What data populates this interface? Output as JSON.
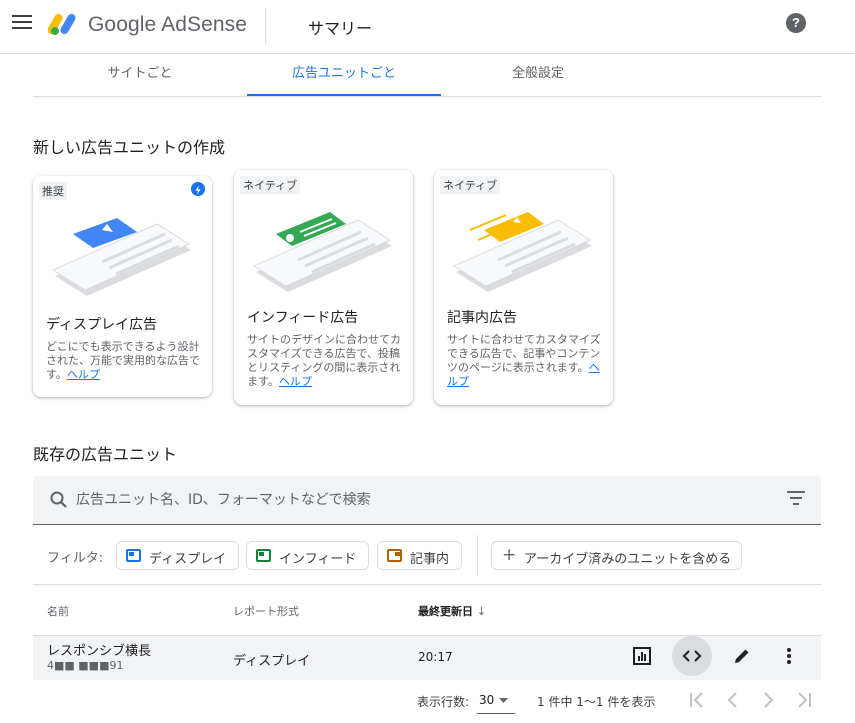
{
  "header": {
    "brand": "Google AdSense",
    "title": "サマリー",
    "help_icon": "?"
  },
  "tabs": [
    {
      "label": "サイトごと",
      "active": false
    },
    {
      "label": "広告ユニットごと",
      "active": true
    },
    {
      "label": "全般設定",
      "active": false
    }
  ],
  "create_section": {
    "title": "新しい広告ユニットの作成",
    "cards": [
      {
        "badge": "推奨",
        "title": "ディスプレイ広告",
        "description": "どこにでも表示できるよう設計された、万能で実用的な広告です。",
        "help": "ヘルプ",
        "accent": "#4285f4",
        "icon": "bolt-icon"
      },
      {
        "badge": "ネイティブ",
        "title": "インフィード広告",
        "description": "サイトのデザインに合わせてカスタマイズできる広告で、投稿とリスティングの間に表示されます。",
        "help": "ヘルプ",
        "accent": "#34a853"
      },
      {
        "badge": "ネイティブ",
        "title": "記事内広告",
        "description": "サイトに合わせてカスタマイズできる広告で、記事やコンテンツのページに表示されます。",
        "help": "ヘルプ",
        "accent": "#fbbc04"
      }
    ]
  },
  "existing_section": {
    "title": "既存の広告ユニット",
    "search": {
      "placeholder": "広告ユニット名、ID、フォーマットなどで検索",
      "value": ""
    },
    "filter": {
      "label": "フィルタ:",
      "chips": [
        {
          "label": "ディスプレイ",
          "color": "#1a73e8"
        },
        {
          "label": "インフィード",
          "color": "#188038"
        },
        {
          "label": "記事内",
          "color": "#b06000"
        }
      ],
      "archive_toggle": "アーカイブ済みのユニットを含める"
    },
    "table": {
      "columns": [
        "名前",
        "レポート形式",
        "最終更新日"
      ],
      "sort_indicator": "↓",
      "rows": [
        {
          "name": "レスポンシブ横長",
          "id": "4■■ ■■■91",
          "type": "ディスプレイ",
          "updated": "20:17"
        }
      ]
    },
    "pagination": {
      "rows_label": "表示行数:",
      "rows_value": "30",
      "range": "1 件中 1～1 件を表示"
    }
  },
  "colors": {
    "accent": "#1a73e8",
    "text": "#202124",
    "muted": "#5f6368",
    "divider": "#dadce0",
    "surface": "#f1f3f4"
  }
}
